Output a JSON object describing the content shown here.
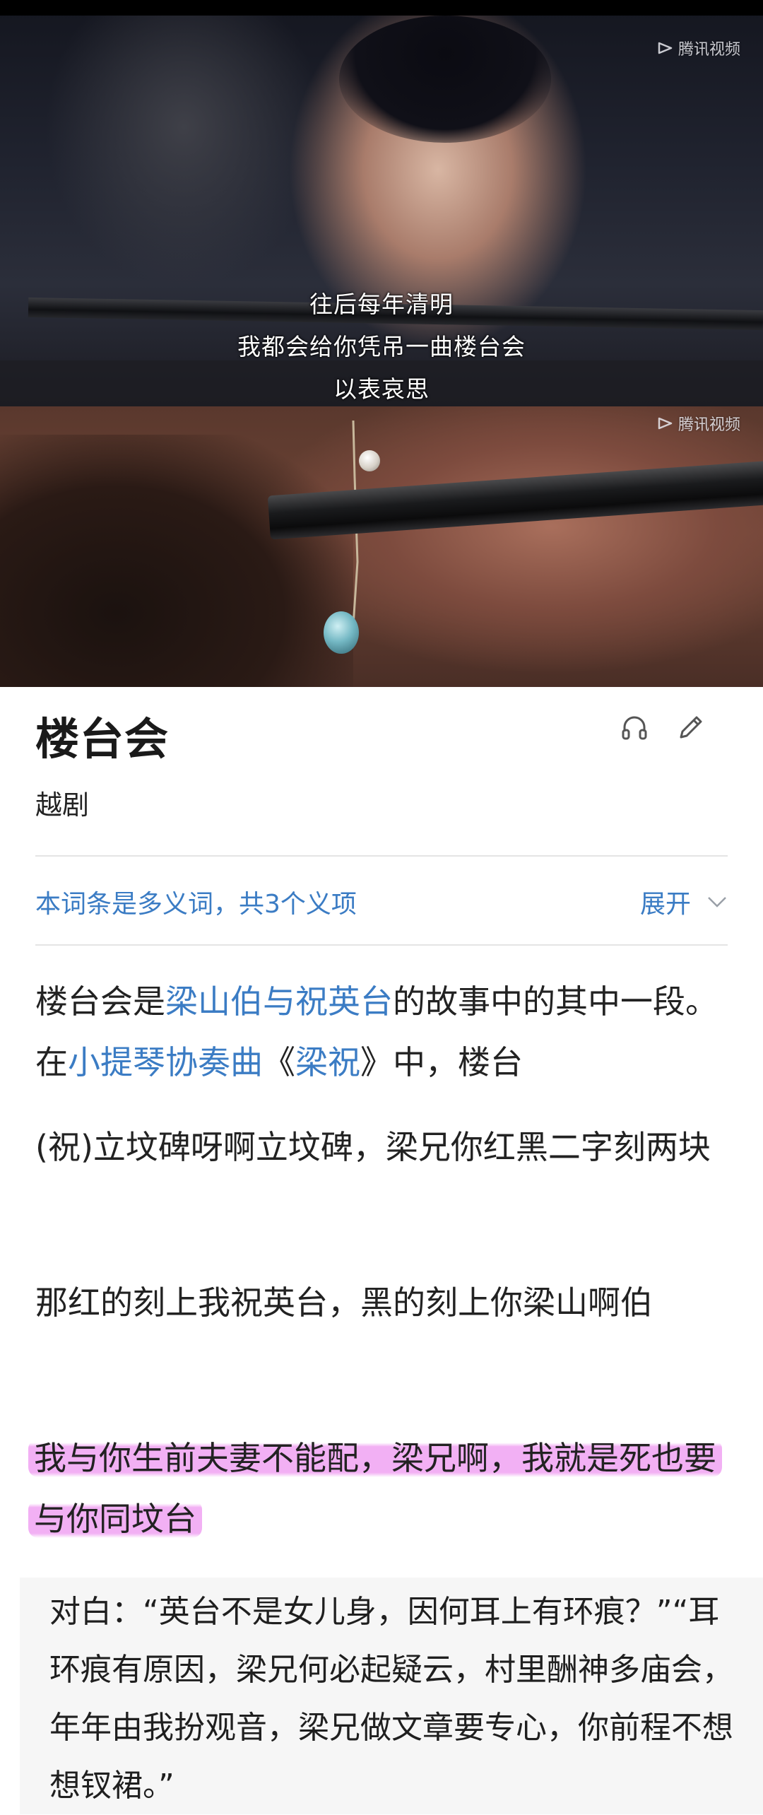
{
  "video": {
    "watermark": "腾讯视频",
    "subtitles": [
      "往后每年清明",
      "我都会给你凭吊一曲楼台会",
      "以表哀思"
    ]
  },
  "entry": {
    "title": "楼台会",
    "category": "越剧",
    "polysemy_note": "本词条是多义词，共3个义项",
    "expand_label": "展开"
  },
  "body": {
    "p1": {
      "part1": "楼台会是",
      "link1": "梁山伯与祝英台",
      "part2": "的故事中的其中一段。在",
      "link2": "小提琴协奏曲",
      "part3": "《",
      "link3": "梁祝",
      "part4": "》中，楼台"
    },
    "p2": "(祝)立坟碑呀啊立坟碑，梁兄你红黑二字刻两块",
    "p3": "那红的刻上我祝英台，黑的刻上你梁山啊伯",
    "p4_highlighted": "我与你生前夫妻不能配，梁兄啊，我就是死也要与你同坟台",
    "dialog": "对白：“英台不是女儿身，因何耳上有环痕？”“耳环痕有原因，梁兄何必起疑云，村里酬神多庙会，年年由我扮观音，梁兄做文章要专心，你前程不想想钗裙。”"
  },
  "colors": {
    "link": "#3b7cc4",
    "highlight": "#ee96f0"
  },
  "icons": [
    "headphones-icon",
    "edit-pencil-icon",
    "chevron-down-icon",
    "tencent-video-logo-icon"
  ]
}
